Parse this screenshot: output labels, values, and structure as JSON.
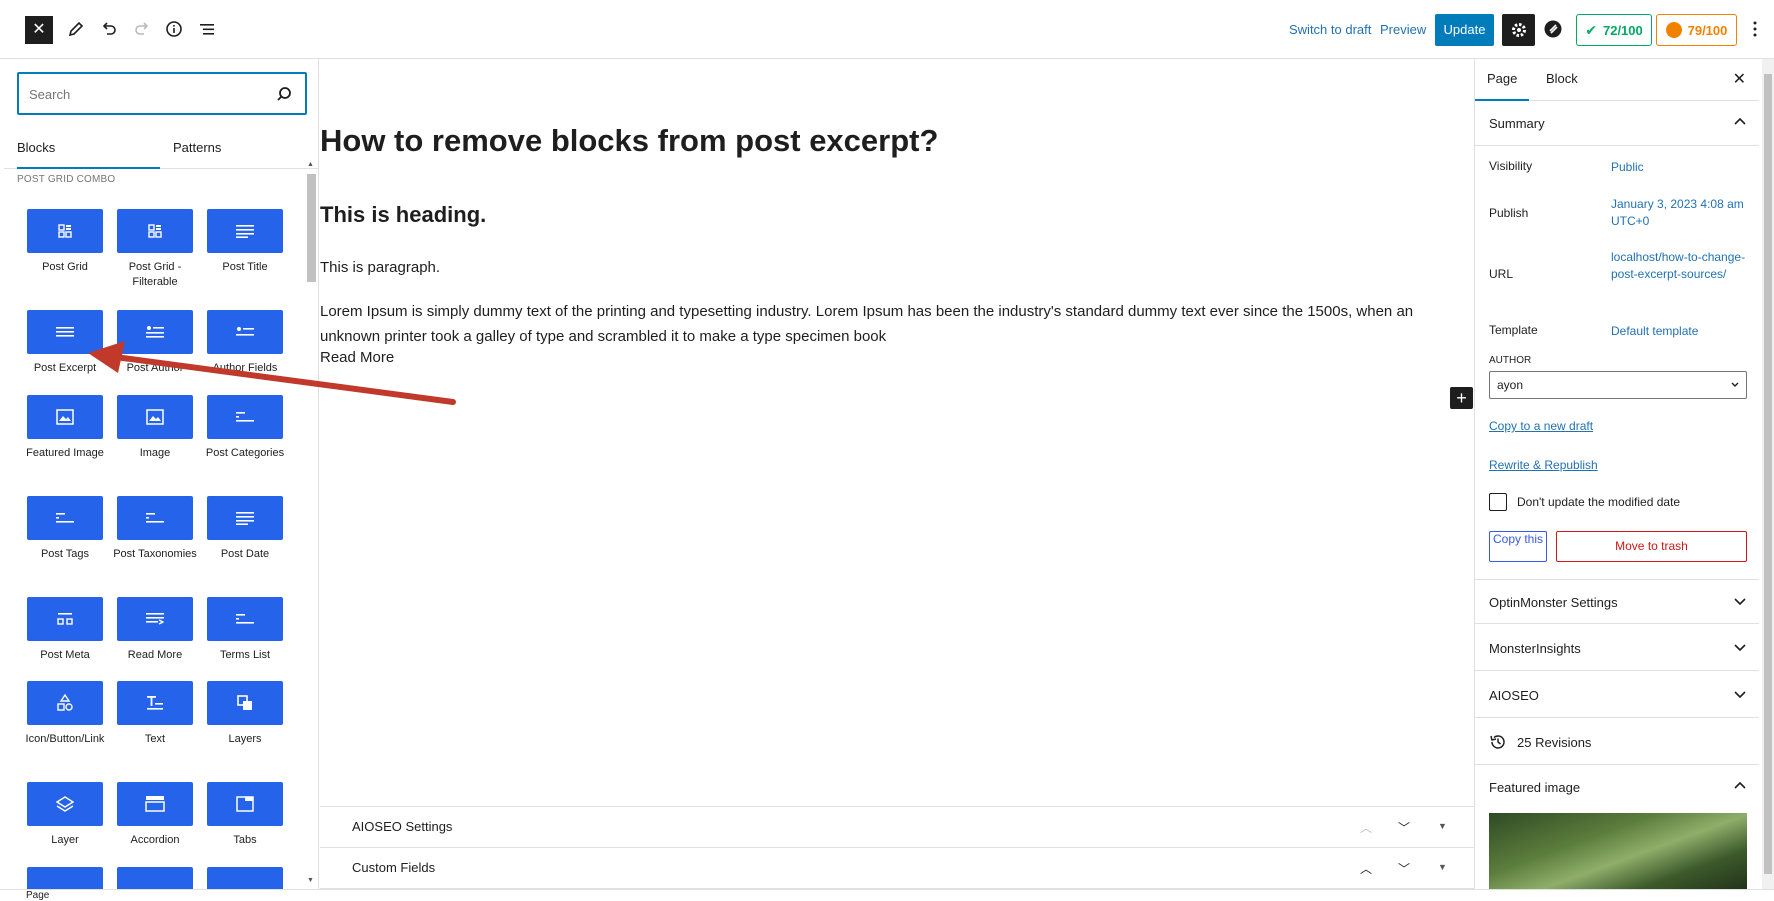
{
  "toolbar": {
    "switch_to_draft": "Switch to draft",
    "preview": "Preview",
    "update": "Update",
    "seo_score": "72/100",
    "readability_score": "79/100",
    "close_icon": "close-icon",
    "accent_color": "#007cba"
  },
  "inserter": {
    "search_placeholder": "Search",
    "tabs": [
      "Blocks",
      "Patterns"
    ],
    "category": "POST GRID COMBO",
    "blocks": [
      {
        "label": "Post Grid",
        "icon": "grid-icon"
      },
      {
        "label": "Post Grid - Filterable",
        "icon": "grid-icon"
      },
      {
        "label": "Post Title",
        "icon": "lines-icon"
      },
      {
        "label": "Post Excerpt",
        "icon": "lines-icon"
      },
      {
        "label": "Post Author",
        "icon": "author-icon"
      },
      {
        "label": "Author Fields",
        "icon": "author-fields-icon"
      },
      {
        "label": "Featured Image",
        "icon": "image-icon"
      },
      {
        "label": "Image",
        "icon": "image-icon"
      },
      {
        "label": "Post Categories",
        "icon": "align-left-icon"
      },
      {
        "label": "Post Tags",
        "icon": "align-left-icon"
      },
      {
        "label": "Post Taxonomies",
        "icon": "align-left-icon"
      },
      {
        "label": "Post Date",
        "icon": "lines-icon"
      },
      {
        "label": "Post Meta",
        "icon": "meta-icon"
      },
      {
        "label": "Read More",
        "icon": "read-more-icon"
      },
      {
        "label": "Terms List",
        "icon": "align-left-icon"
      },
      {
        "label": "Icon/Button/Link",
        "icon": "shapes-icon"
      },
      {
        "label": "Text",
        "icon": "text-icon"
      },
      {
        "label": "Layers",
        "icon": "layers-icon"
      },
      {
        "label": "Layer",
        "icon": "layer-icon"
      },
      {
        "label": "Accordion",
        "icon": "accordion-icon"
      },
      {
        "label": "Tabs",
        "icon": "tabs-icon"
      }
    ],
    "block_color": "#2563eb"
  },
  "post": {
    "title": "How to remove blocks from post excerpt?",
    "heading": "This is heading.",
    "paragraph": "This is  paragraph.",
    "excerpt": "Lorem Ipsum is simply dummy text of the printing and typesetting industry. Lorem Ipsum has been the industry's standard dummy text ever since the 1500s, when an unknown printer took a galley of type and scrambled it to make a type specimen book",
    "read_more": "Read More"
  },
  "meta_boxes": [
    "AIOSEO Settings",
    "Custom Fields"
  ],
  "sidebar": {
    "tabs": [
      "Page",
      "Block"
    ],
    "summary": {
      "title": "Summary",
      "visibility_label": "Visibility",
      "visibility_value": "Public",
      "publish_label": "Publish",
      "publish_value": "January 3, 2023 4:08 am UTC+0",
      "url_label": "URL",
      "url_value": "localhost/how-to-change-post-excerpt-sources/",
      "template_label": "Template",
      "template_value": "Default template",
      "author_label": "AUTHOR",
      "author_value": "ayon",
      "copy_new_draft": "Copy to a new draft",
      "rewrite_republish": "Rewrite & Republish",
      "dont_update_label": "Don't update the modified date",
      "copy_this": "Copy this",
      "move_to_trash": "Move to trash"
    },
    "panels": [
      "OptinMonster Settings",
      "MonsterInsights",
      "AIOSEO"
    ],
    "revisions": "25 Revisions",
    "featured_image": "Featured image"
  },
  "footer": {
    "breadcrumb": "Page"
  },
  "annotation": {
    "arrow_color": "#c0392b"
  }
}
